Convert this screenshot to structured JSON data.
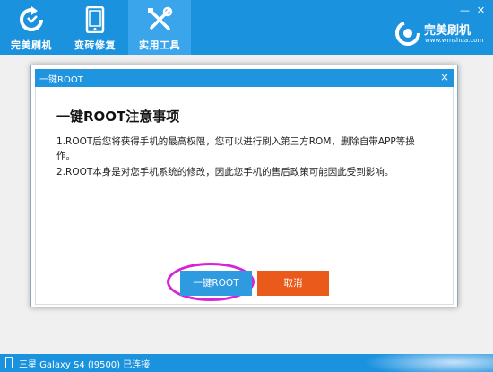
{
  "header": {
    "tabs": [
      {
        "label": "完美刷机",
        "icon": "refresh-icon",
        "active": false
      },
      {
        "label": "变砖修复",
        "icon": "phone-icon",
        "active": false
      },
      {
        "label": "实用工具",
        "icon": "tools-icon",
        "active": true
      }
    ],
    "window_controls": {
      "minimize": "—",
      "close": "✕"
    },
    "brand": {
      "name": "完美刷机",
      "url": "www.wmshua.com"
    }
  },
  "dialog": {
    "title": "一键ROOT",
    "close_label": "×",
    "heading": "一键ROOT注意事项",
    "notices": [
      "1.ROOT后您将获得手机的最高权限，您可以进行刷入第三方ROM，删除自带APP等操作。",
      "2.ROOT本身是对您手机系统的修改，因此您手机的售后政策可能因此受到影响。"
    ],
    "buttons": {
      "confirm": "一键ROOT",
      "cancel": "取消"
    }
  },
  "status": {
    "device": "三星 Galaxy S4 (I9500) 已连接"
  },
  "colors": {
    "header_blue": "#1a92de",
    "active_tab": "#3aa5ea",
    "confirm_button": "#2e9ae0",
    "cancel_button": "#ea5a1a",
    "highlight": "#d624d6"
  }
}
